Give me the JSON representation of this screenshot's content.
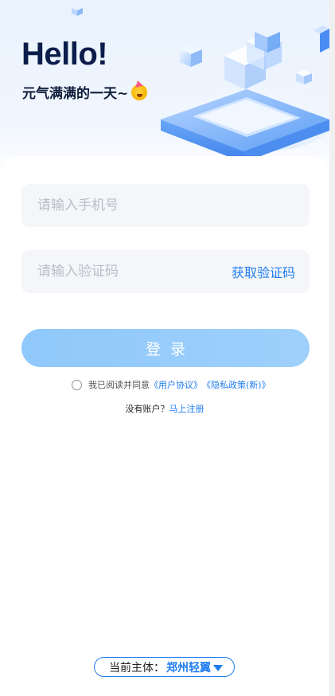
{
  "hero": {
    "title": "Hello!",
    "subtitle": "元气满满的一天~"
  },
  "form": {
    "phone_placeholder": "请输入手机号",
    "code_placeholder": "请输入验证码",
    "get_code_label": "获取验证码",
    "login_label": "登录"
  },
  "agreement": {
    "prefix": "我已阅读并同意",
    "user_agreement": "《用户协议》",
    "privacy_policy": "《隐私政策(新)》"
  },
  "register": {
    "prompt": "没有账户？",
    "link": "马上注册"
  },
  "entity": {
    "label": "当前主体：",
    "name": "郑州轻翼"
  },
  "colors": {
    "accent": "#1f7cf0",
    "login_button": "#9fd0fb",
    "title": "#0b1d4a",
    "field_bg": "#f4f6f9"
  },
  "icons": [
    "party-emoji-icon",
    "radio-icon",
    "caret-down-icon"
  ]
}
